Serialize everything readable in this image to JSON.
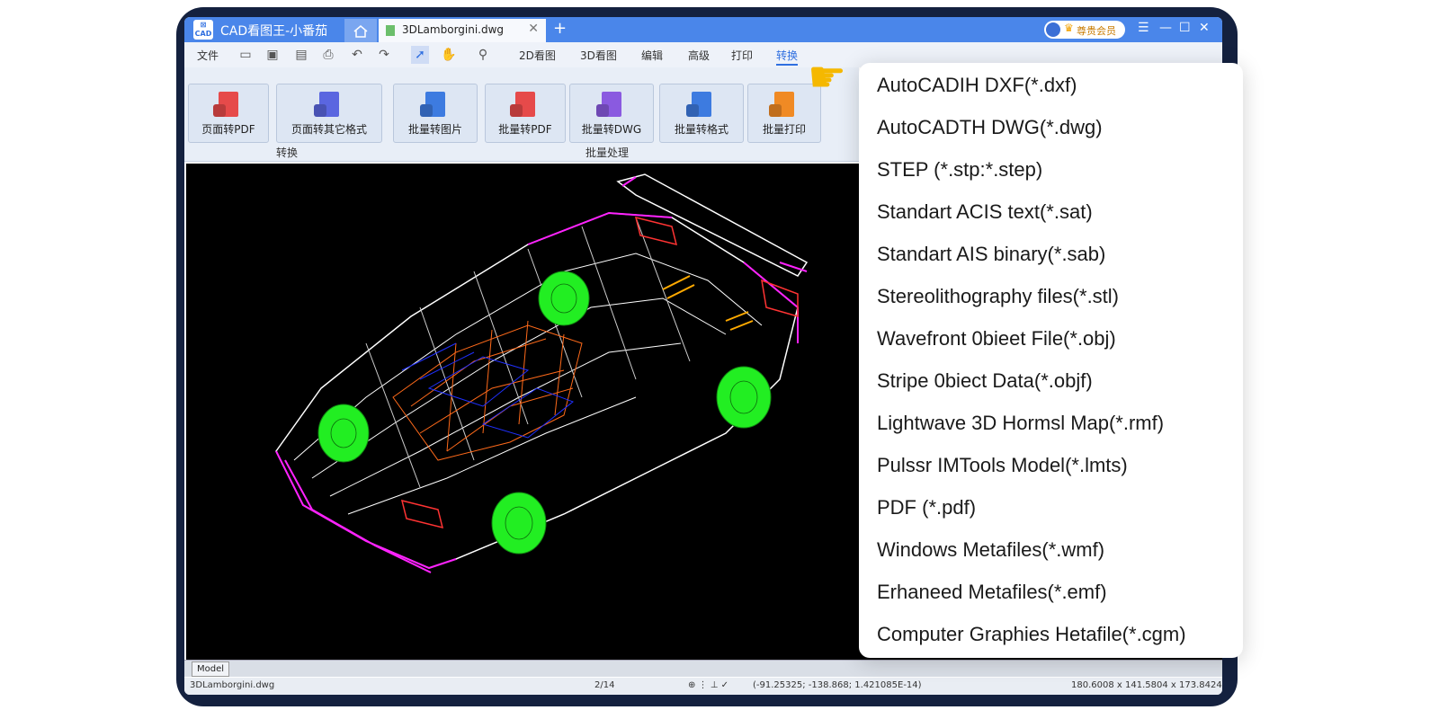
{
  "titlebar": {
    "logo_text": "CAD",
    "app_title": "CAD看图王-小番茄",
    "file_tab": "3DLamborgini.dwg",
    "vip_label": "尊贵会员",
    "icons": [
      "home-icon",
      "plus-icon",
      "menu-icon",
      "minimize-icon",
      "maximize-icon",
      "close-icon"
    ]
  },
  "menubar": {
    "file": "文件",
    "tabs": [
      "2D看图",
      "3D看图",
      "编辑",
      "高级",
      "打印",
      "转换"
    ],
    "active_tab": "转换"
  },
  "ribbon": {
    "buttons": [
      {
        "label": "页面转PDF",
        "color": "#e64a4a"
      },
      {
        "label": "页面转其它格式",
        "color": "#5a66e0"
      },
      {
        "label": "批量转图片",
        "color": "#3d7be0"
      },
      {
        "label": "批量转PDF",
        "color": "#e64a4a"
      },
      {
        "label": "批量转DWG",
        "color": "#8a5ae0"
      },
      {
        "label": "批量转格式",
        "color": "#3d7be0"
      },
      {
        "label": "批量打印",
        "color": "#f08a24"
      }
    ],
    "groups": [
      "转换",
      "批量处理"
    ]
  },
  "model_tab": "Model",
  "status": {
    "file": "3DLamborgini.dwg",
    "page": "2/14",
    "coords": "(-91.25325; -138.868; 1.421085E-14)",
    "dims": "180.6008 x 141.5804 x 173.8424"
  },
  "dropdown_items": [
    "AutoCADIH DXF(*.dxf)",
    "AutoCADTH DWG(*.dwg)",
    "STEP (*.stp:*.step)",
    "Standart ACIS text(*.sat)",
    "Standart AIS binary(*.sab)",
    "Stereolithography files(*.stl)",
    "Wavefront 0bieet File(*.obj)",
    "Stripe 0biect Data(*.objf)",
    "Lightwave 3D Hormsl Map(*.rmf)",
    "Pulssr IMTools Model(*.lmts)",
    "PDF (*.pdf)",
    "Windows Metafiles(*.wmf)",
    "Erhaneed Metafiles(*.emf)",
    "Computer Graphies Hetafile(*.cgm)"
  ],
  "colors": {
    "accent": "#4a86ea",
    "wire_white": "#ffffff",
    "wire_magenta": "#ff22ff",
    "wire_orange": "#ff6a1a",
    "wire_blue": "#2030ff",
    "wheel_green": "#22ee22"
  }
}
